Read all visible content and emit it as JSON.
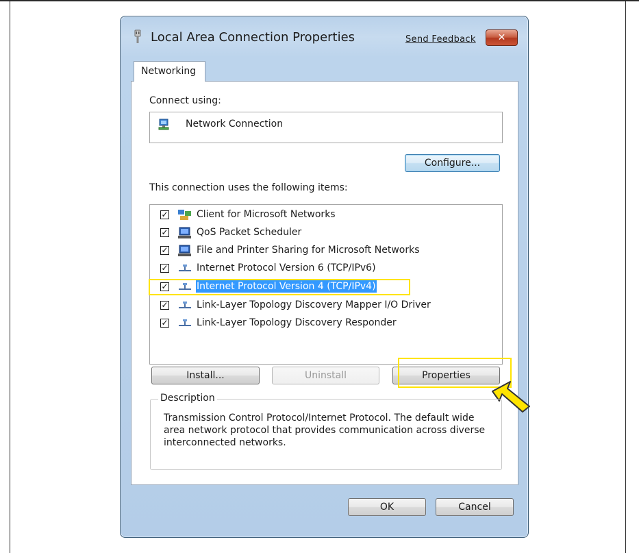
{
  "window": {
    "title": "Local Area Connection Properties",
    "feedback_link": "Send Feedback",
    "close_label": "✕",
    "title_icon": "network-plug-icon"
  },
  "tabs": [
    {
      "label": "Networking"
    }
  ],
  "connect_using": {
    "label": "Connect using:",
    "adapter_name": "Network Connection",
    "adapter_icon": "network-adapter-icon",
    "configure_label": "Configure..."
  },
  "items_section": {
    "label": "This connection uses the following items:",
    "items": [
      {
        "label": "Client for Microsoft Networks",
        "checked": true,
        "icon": "network-client-icon"
      },
      {
        "label": "QoS Packet Scheduler",
        "checked": true,
        "icon": "service-icon"
      },
      {
        "label": "File and Printer Sharing for Microsoft Networks",
        "checked": true,
        "icon": "service-icon"
      },
      {
        "label": "Internet Protocol Version 6 (TCP/IPv6)",
        "checked": true,
        "icon": "protocol-icon"
      },
      {
        "label": "Internet Protocol Version 4 (TCP/IPv4)",
        "checked": true,
        "icon": "protocol-icon",
        "selected": true
      },
      {
        "label": "Link-Layer Topology Discovery Mapper I/O Driver",
        "checked": true,
        "icon": "protocol-icon"
      },
      {
        "label": "Link-Layer Topology Discovery Responder",
        "checked": true,
        "icon": "protocol-icon"
      }
    ]
  },
  "buttons": {
    "install": "Install...",
    "uninstall": "Uninstall",
    "properties": "Properties",
    "ok": "OK",
    "cancel": "Cancel"
  },
  "description": {
    "legend": "Description",
    "text": "Transmission Control Protocol/Internet Protocol. The default wide area network protocol that provides communication across diverse interconnected networks."
  },
  "colors": {
    "highlight": "#ffe400",
    "selection": "#3399ff",
    "window_frame": "#b9d1ea"
  }
}
